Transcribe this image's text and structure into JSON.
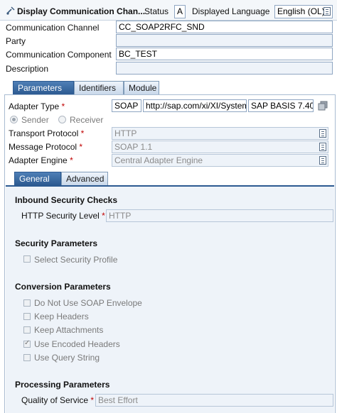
{
  "header": {
    "title": "Display Communication Chan...",
    "status_label": "Status",
    "status_value": "A",
    "language_label": "Displayed Language",
    "language_value": "English (OL)"
  },
  "channel": {
    "communication_channel_label": "Communication Channel",
    "communication_channel_value": "CC_SOAP2RFC_SND",
    "party_label": "Party",
    "party_value": "",
    "communication_component_label": "Communication Component",
    "communication_component_value": "BC_TEST",
    "description_label": "Description",
    "description_value": ""
  },
  "tabs": [
    {
      "label": "Parameters",
      "active": true
    },
    {
      "label": "Identifiers",
      "active": false
    },
    {
      "label": "Module",
      "active": false
    }
  ],
  "parameters": {
    "adapter_type_label": "Adapter Type",
    "adapter_type_name": "SOAP",
    "adapter_type_namespace": "http://sap.com/xi/XI/System",
    "adapter_type_swcv": "SAP BASIS 7.40",
    "sender_label": "Sender",
    "receiver_label": "Receiver",
    "transport_protocol_label": "Transport Protocol",
    "transport_protocol_value": "HTTP",
    "message_protocol_label": "Message Protocol",
    "message_protocol_value": "SOAP 1.1",
    "adapter_engine_label": "Adapter Engine",
    "adapter_engine_value": "Central Adapter Engine"
  },
  "subtabs": [
    {
      "label": "General",
      "active": true
    },
    {
      "label": "Advanced",
      "active": false
    }
  ],
  "general": {
    "inbound_security_title": "Inbound Security Checks",
    "http_security_level_label": "HTTP Security Level",
    "http_security_level_value": "HTTP",
    "security_params_title": "Security Parameters",
    "select_security_profile": "Select Security Profile",
    "conversion_params_title": "Conversion Parameters",
    "conversion_options": [
      {
        "label": "Do Not Use SOAP Envelope",
        "checked": false
      },
      {
        "label": "Keep Headers",
        "checked": false
      },
      {
        "label": "Keep Attachments",
        "checked": false
      },
      {
        "label": "Use Encoded Headers",
        "checked": true
      },
      {
        "label": "Use Query String",
        "checked": false
      }
    ],
    "processing_params_title": "Processing Parameters",
    "quality_of_service_label": "Quality of Service",
    "quality_of_service_value": "Best Effort"
  },
  "colors": {
    "active_tab": "#2c5a91",
    "field_border": "#8fa6c2",
    "required": "#c00000",
    "panel_bg": "#eef3f9"
  }
}
